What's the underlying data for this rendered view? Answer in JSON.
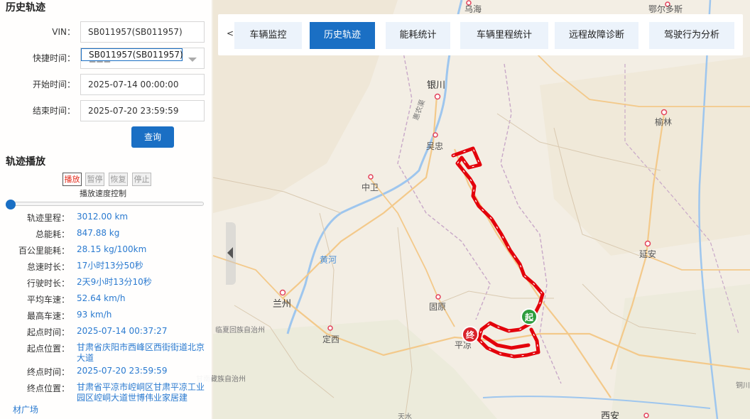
{
  "panel": {
    "history_title": "历史轨迹",
    "vin_label": "VIN：",
    "vin_value": "SB011957(SB011957)",
    "quick_label": "快捷时间：",
    "quick_value": "SB011957(SB011957)",
    "start_label": "开始时间：",
    "start_value": "2025-07-14 00:00:00",
    "end_label": "结束时间：",
    "end_value": "2025-07-20 23:59:59",
    "query_label": "查询",
    "playback_title": "轨迹播放",
    "play_label": "播放",
    "pause_label": "暂停",
    "resume_label": "恢复",
    "stop_label": "停止",
    "speed_label": "播放速度控制",
    "speed_value": 0
  },
  "stats": [
    {
      "label": "轨迹里程：",
      "value": "3012.00 km"
    },
    {
      "label": "总能耗：",
      "value": "847.88 kg"
    },
    {
      "label": "百公里能耗：",
      "value": "28.15 kg/100km"
    },
    {
      "label": "怠速时长：",
      "value": "17小时13分50秒"
    },
    {
      "label": "行驶时长：",
      "value": "2天9小时13分10秒"
    },
    {
      "label": "平均车速：",
      "value": "52.64 km/h"
    },
    {
      "label": "最高车速：",
      "value": "93 km/h"
    },
    {
      "label": "起点时间：",
      "value": "2025-07-14 00:37:27"
    },
    {
      "label": "起点位置：",
      "value": "甘肃省庆阳市西峰区西街街道北京大道"
    },
    {
      "label": "终点时间：",
      "value": "2025-07-20 23:59:59"
    },
    {
      "label": "终点位置：",
      "value": "甘肃省平凉市崆峒区甘肃平凉工业园区崆峒大道世博伟业家居建"
    }
  ],
  "map": {
    "poi_text": "材广场",
    "start_marker": "起",
    "end_marker": "终",
    "cities": {
      "wuhai": "乌海",
      "yinchuan": "银川",
      "wuzhong": "吴忠",
      "zhongwei": "中卫",
      "yulin": "榆林",
      "yanan": "延安",
      "lanzhou": "兰州",
      "guyuan": "固原",
      "dingxi": "定西",
      "pingliang": "平凉",
      "tongchuan": "铜川",
      "xian": "西安",
      "ordos": "鄂尔多斯",
      "tianshui": "天水"
    },
    "river": "黄河",
    "region1": "临夏回族自治州",
    "region2": "甘南藏族自治州",
    "canal": "惠农渠"
  },
  "tabs": [
    {
      "label": "车辆监控",
      "active": false
    },
    {
      "label": "历史轨迹",
      "active": true
    },
    {
      "label": "能耗统计",
      "active": false
    },
    {
      "label": "车辆里程统计",
      "active": false
    },
    {
      "label": "远程故障诊断",
      "active": false
    },
    {
      "label": "驾驶行为分析",
      "active": false
    }
  ],
  "tab_prev": "<",
  "colors": {
    "accent": "#1a6fc4",
    "track": "#e3000b",
    "start_marker": "#2e9d3e",
    "end_marker": "#d9222a"
  }
}
